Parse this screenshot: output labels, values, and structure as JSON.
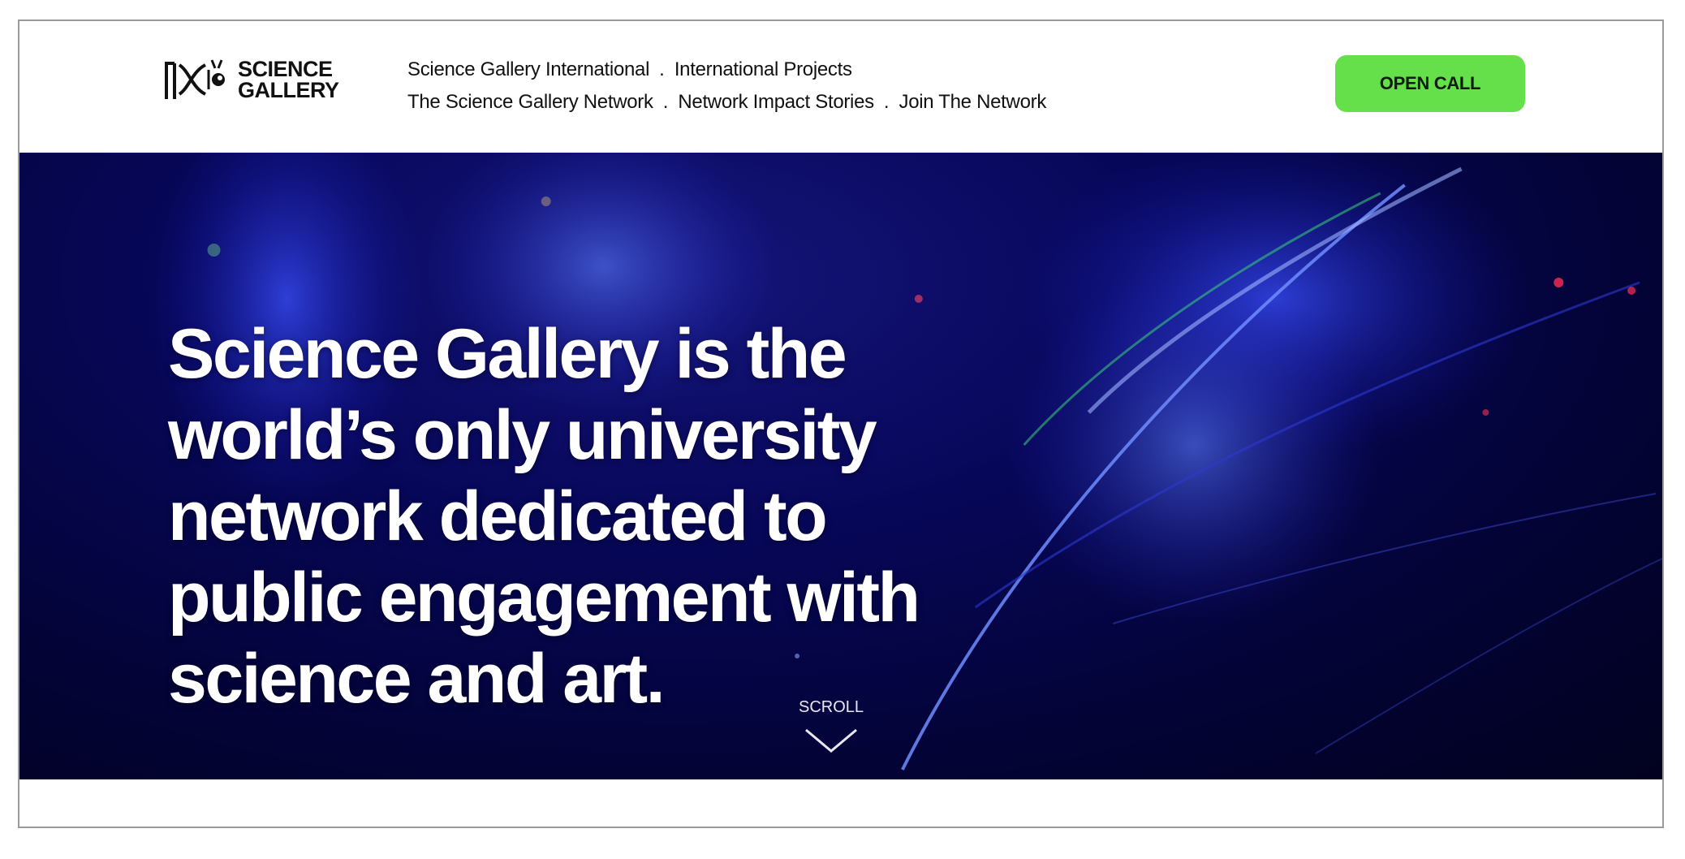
{
  "brand": {
    "logo_line1": "SCIENCE",
    "logo_line2": "GALLERY"
  },
  "nav": {
    "row1": [
      "Science Gallery International",
      "International Projects"
    ],
    "row2": [
      "The Science Gallery Network",
      "Network Impact Stories",
      "Join The Network"
    ],
    "separator": "."
  },
  "cta": {
    "label": "OPEN CALL",
    "color": "#66e04a"
  },
  "hero": {
    "title_lines": [
      "Science Gallery is the",
      "world’s only university",
      "network dedicated to",
      "public engagement with",
      "science and art."
    ],
    "scroll_label": "SCROLL",
    "scroll_icon": "chevron-down-icon",
    "background_color": "#05054a"
  }
}
